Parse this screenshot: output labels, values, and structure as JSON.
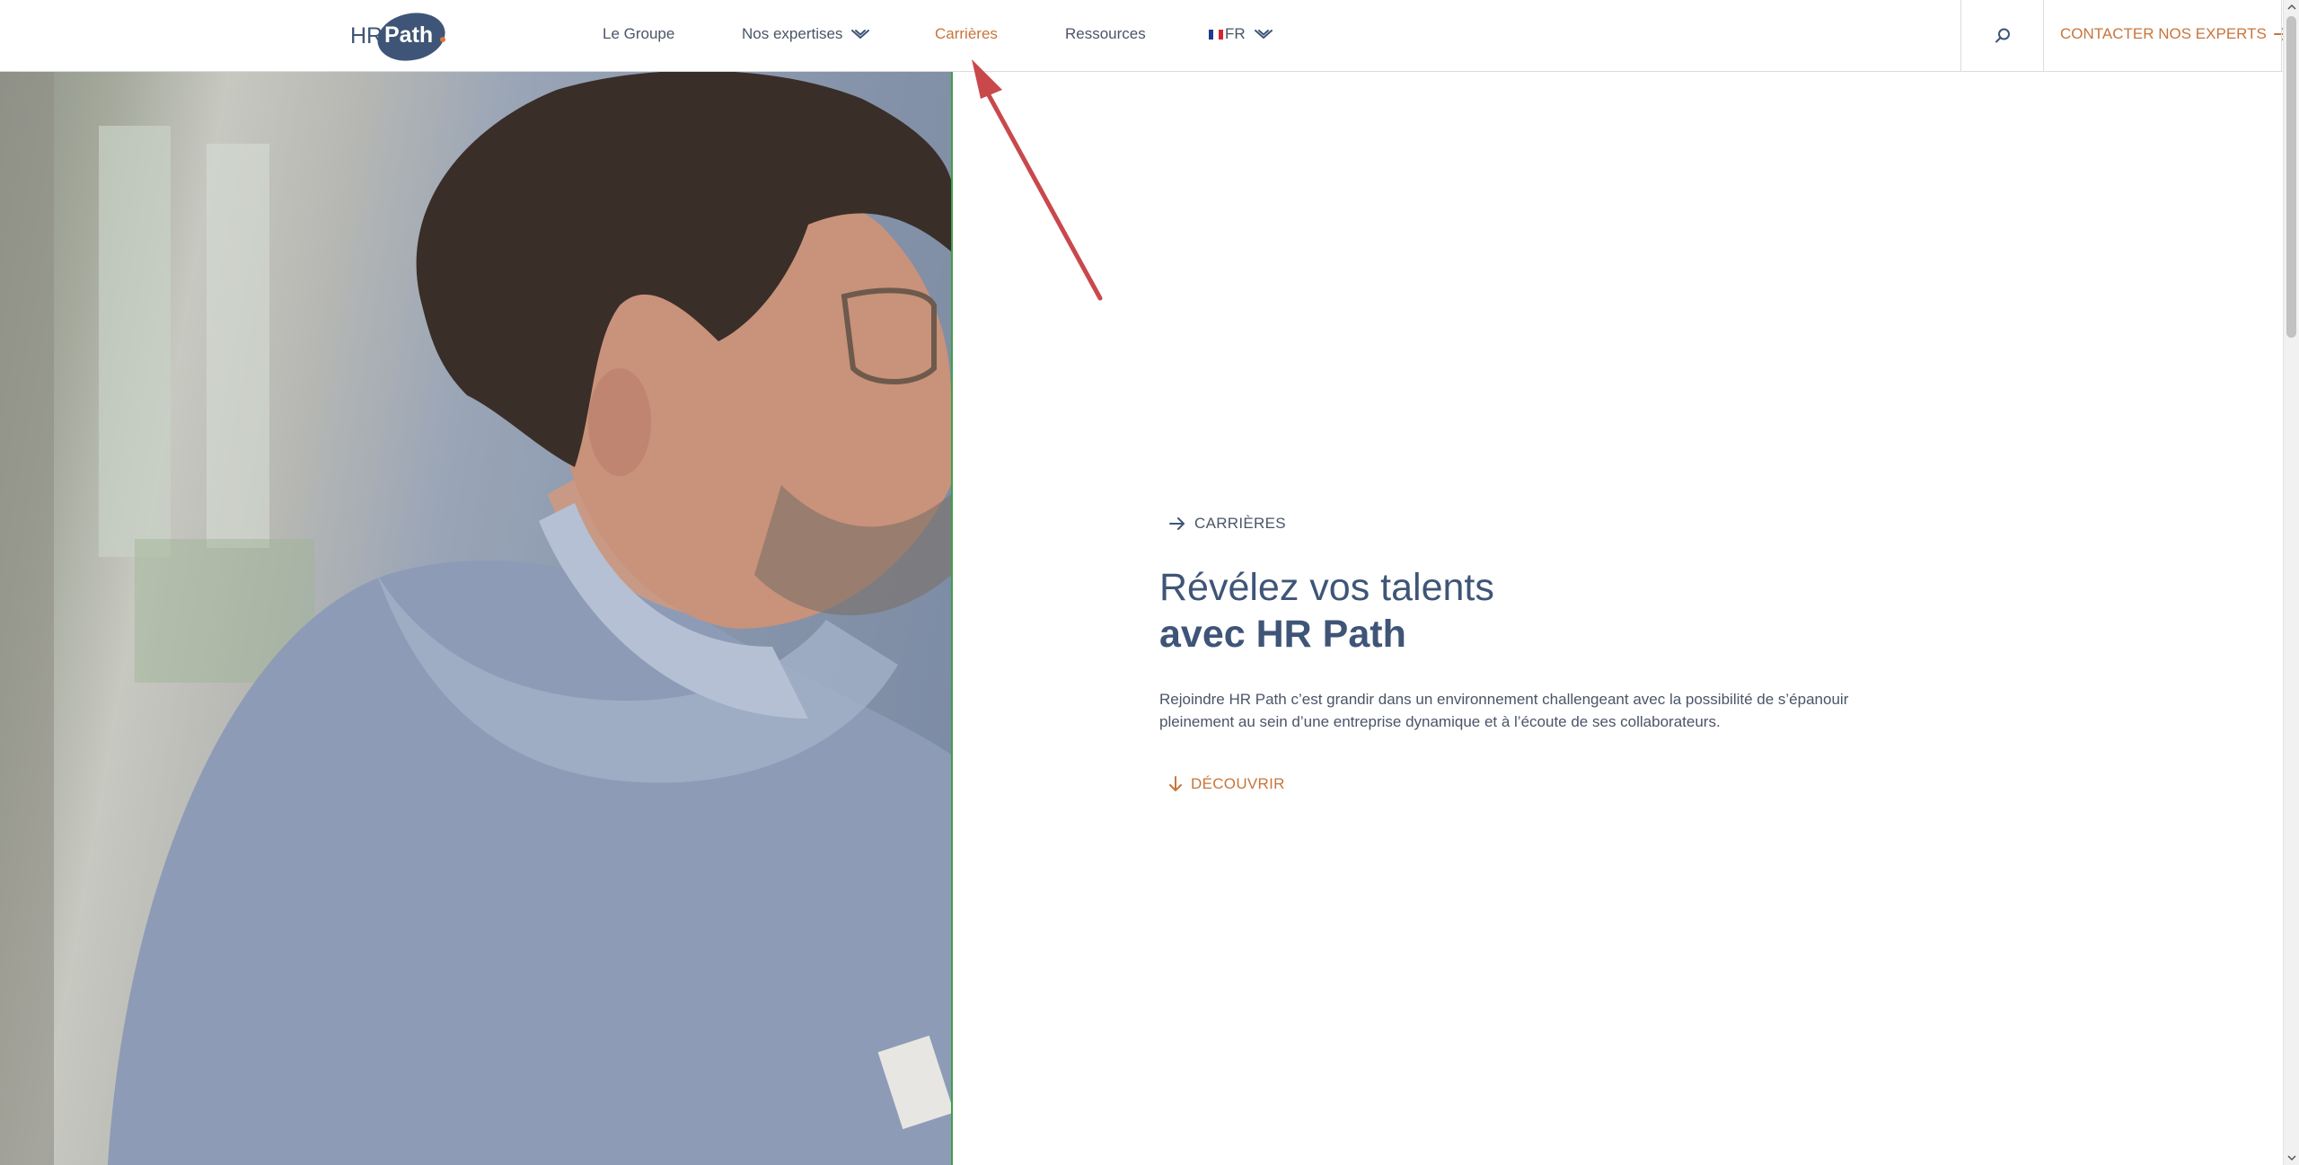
{
  "header": {
    "logo": {
      "text_hr": "HR",
      "text_path": "Path",
      "dot_color": "#e2733a",
      "brand_color": "#3f5577"
    },
    "nav": [
      {
        "label": "Le Groupe",
        "has_dropdown": false,
        "active": false
      },
      {
        "label": "Nos expertises",
        "has_dropdown": true,
        "active": false
      },
      {
        "label": "Carrières",
        "has_dropdown": false,
        "active": true
      },
      {
        "label": "Ressources",
        "has_dropdown": false,
        "active": false
      }
    ],
    "language": {
      "label": "FR",
      "flag": "flag-fr-icon",
      "colors": [
        "#1f3b8f",
        "#ffffff",
        "#d8262e"
      ]
    },
    "search_icon": "search-icon",
    "contact_label": "CONTACTER NOS EXPERTS"
  },
  "hero": {
    "eyebrow": "CARRIÈRES",
    "title_line1": "Révélez vos talents",
    "title_line2": "avec HR Path",
    "lead": "Rejoindre HR Path c’est grandir dans un environnement challengeant avec la possibilité de s’épanouir pleinement au sein d’une entreprise dynamique et à l’écoute de ses collaborateurs.",
    "cta": "DÉCOUVRIR"
  },
  "colors": {
    "accent": "#c8753b",
    "primary": "#3f5577",
    "text": "#4a5568",
    "annotation": "#c9484c",
    "photo_divider": "#3fa046"
  }
}
